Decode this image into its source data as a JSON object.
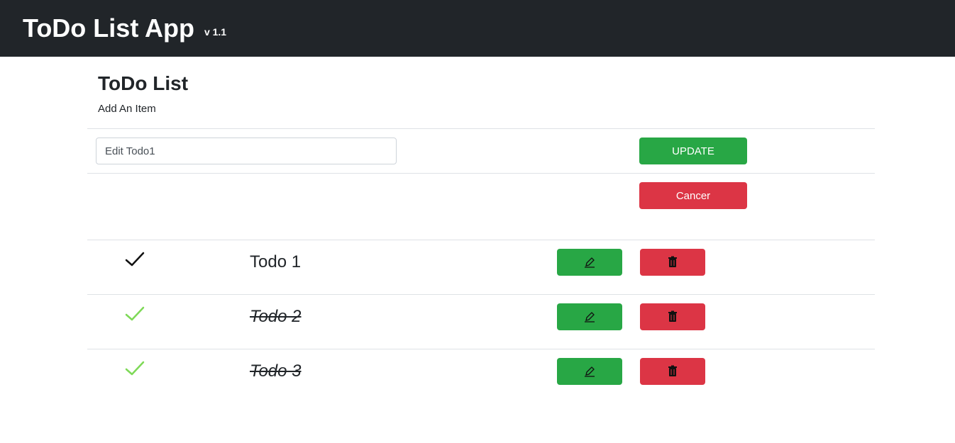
{
  "header": {
    "title": "ToDo List App",
    "version": "v 1.1"
  },
  "main": {
    "title": "ToDo List",
    "subtitle": "Add An Item",
    "edit_input": {
      "value": "Edit Todo1"
    },
    "update_label": "UPDATE",
    "cancel_label": "Cancer"
  },
  "todos": [
    {
      "text": "Todo 1",
      "completed": false,
      "check_color": "#111111"
    },
    {
      "text": "Todo 2",
      "completed": true,
      "check_color": "#7ed957"
    },
    {
      "text": "Todo 3",
      "completed": true,
      "check_color": "#7ed957"
    }
  ],
  "icons": {
    "edit": "pencil-icon",
    "delete": "trash-icon"
  },
  "colors": {
    "success": "#28a745",
    "danger": "#dc3545",
    "navbar": "#212529"
  }
}
